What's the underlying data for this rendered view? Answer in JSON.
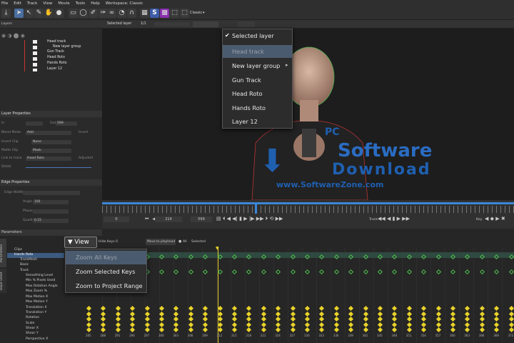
{
  "menubar": [
    "File",
    "Edit",
    "Track",
    "View",
    "Movie",
    "Tools",
    "Help",
    "Workspace: Classic"
  ],
  "toolbar": {
    "workspace_select": "Classic",
    "layer_select": "Selected layer",
    "zoom_value": "1/1"
  },
  "layers_panel": {
    "title": "Layers",
    "items": [
      "Head track",
      "New layer group",
      "Gun Track",
      "Head Roto",
      "Hands Roto",
      "Layer 12"
    ]
  },
  "layer_properties": {
    "title": "Layer Properties",
    "fields": [
      {
        "label": "In",
        "value": ""
      },
      {
        "label": "Blend Mode",
        "value": "Add"
      },
      {
        "label": "Invert Clip",
        "value": "None"
      },
      {
        "label": "Matte Clip",
        "value": "Mask"
      },
      {
        "label": "Link to track",
        "value": "Head Roto"
      },
      {
        "label": "Detail",
        "value": ""
      }
    ],
    "out_label": "Out",
    "out_value": "599",
    "invert_label": "Invert",
    "adjusted_label": "Adjusted"
  },
  "edge_properties": {
    "title": "Edge Properties",
    "fields": [
      "Edge Width",
      "Angle",
      "Phase",
      "Quality"
    ],
    "angle_value": "100",
    "quality_value": "0.15"
  },
  "layer_dropdown": {
    "checked_index": 0,
    "highlight_index": 1,
    "items": [
      "Selected layer",
      "Head track",
      "New layer group",
      "Gun Track",
      "Head Roto",
      "Hands Roto",
      "Layer 12"
    ]
  },
  "timeline": {
    "start_frame": "0",
    "current_frame": "214",
    "end_frame": "599",
    "track_label": "Track",
    "key_label": "Key"
  },
  "params_panel": {
    "title": "Parameters",
    "tabs": [
      "Parameters",
      "Dope Sheet"
    ],
    "hide_keys_label": "Hide Keys",
    "hide_keys_value": "0",
    "move_to_playhead": "Move to playhead",
    "all_label": "All",
    "selected_label": "Selected",
    "tree": [
      "Clips",
      "Hands Roto",
      "TrackMesh",
      "Basic",
      "Track",
      "Smoothing Level",
      "Min % Pixels Used",
      "Max Rotation Angle",
      "Max Zoom %",
      "Max Motion X",
      "Max Motion Y",
      "Translation X",
      "Translation Y",
      "Rotation",
      "Scale",
      "Shear X",
      "Shear Y",
      "Perspective X"
    ],
    "frame_numbers": [
      "285",
      "288",
      "291",
      "294",
      "297",
      "300",
      "303",
      "306",
      "309",
      "312",
      "315",
      "318",
      "321",
      "324",
      "327",
      "330",
      "333",
      "336",
      "339",
      "342",
      "345",
      "348",
      "351",
      "354",
      "357",
      "360",
      "363",
      "366",
      "369",
      "372",
      "375"
    ]
  },
  "view_menu": {
    "button_label": "View",
    "highlight_index": 0,
    "items": [
      "Zoom All Keys",
      "Zoom Selected Keys",
      "Zoom to Project Range"
    ]
  },
  "watermark": {
    "line1": "PC",
    "line2": "Software",
    "line3": "Download",
    "line4": "www.SoftwareZone.com"
  },
  "colors": {
    "accent": "#4b5b6f",
    "keyframe": "#e8d22a",
    "keyframe_green": "#4fbf4f",
    "playhead": "#e8d22a",
    "watermark": "#1f5fb0"
  }
}
